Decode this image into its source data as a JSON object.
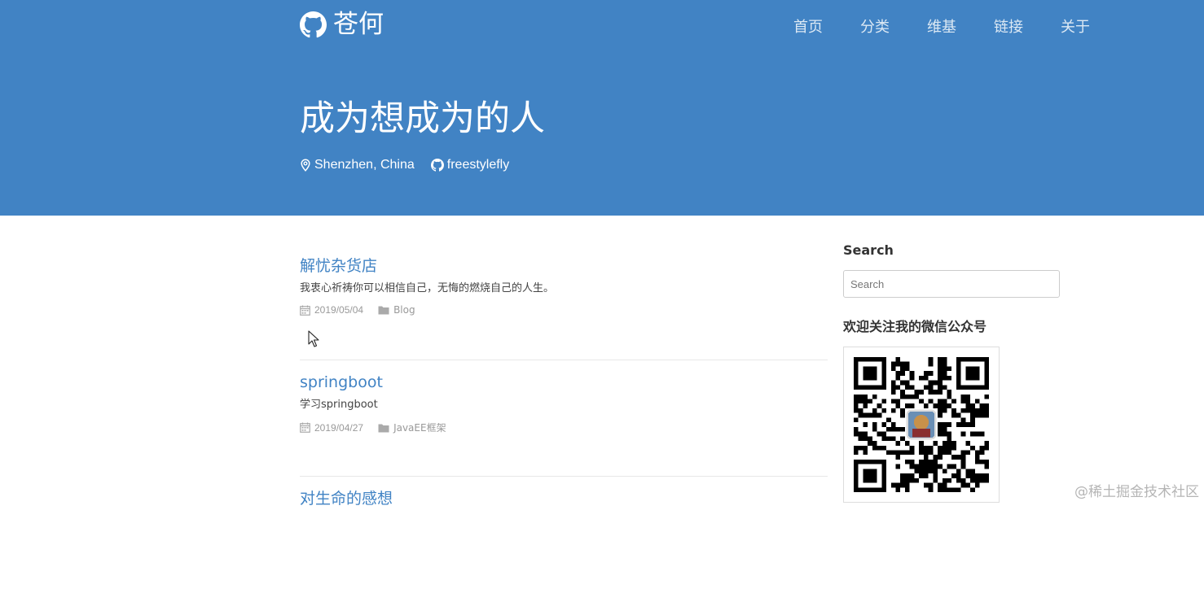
{
  "header": {
    "brand": "苍何",
    "nav": [
      "首页",
      "分类",
      "维基",
      "链接",
      "关于"
    ],
    "title": "成为想成为的人",
    "location": "Shenzhen, China",
    "github": "freestylefly"
  },
  "posts": [
    {
      "title": "解忧杂货店",
      "desc": "我衷心祈祷你可以相信自己，无悔的燃烧自己的人生。",
      "date": "2019/05/04",
      "category": "Blog"
    },
    {
      "title": "springboot",
      "desc": "学习springboot",
      "date": "2019/04/27",
      "category": "JavaEE框架"
    },
    {
      "title": "对生命的感想"
    }
  ],
  "sidebar": {
    "search_heading": "Search",
    "search_placeholder": "Search",
    "wechat_heading": "欢迎关注我的微信公众号"
  },
  "watermark": "@稀土掘金技术社区",
  "colors": {
    "header_bg": "#4183c4",
    "link": "#4183c4"
  }
}
